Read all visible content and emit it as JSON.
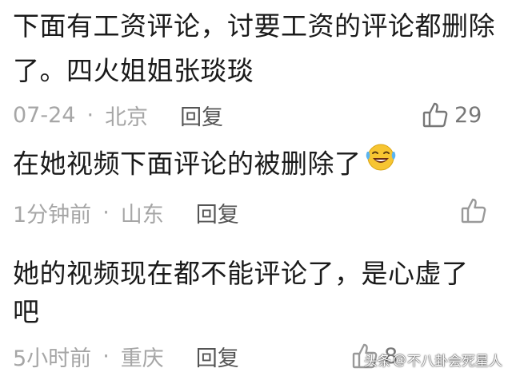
{
  "comments": [
    {
      "lines": [
        "下面有工资评论，讨要工资的评论都删除",
        "了。四火姐姐张琰琰"
      ],
      "location_time": "07-24",
      "region": "北京",
      "reply_label": "回复",
      "likes": "29"
    },
    {
      "lines": [
        "在她视频下面评论的被删除了"
      ],
      "emoji_name": "laughing-crying-emoji",
      "location_time": "1分钟前",
      "region": "山东",
      "reply_label": "回复",
      "likes": ""
    },
    {
      "lines": [
        "她的视频现在都不能评论了，是心虚了",
        "吧"
      ],
      "location_time": "5小时前",
      "region": "重庆",
      "reply_label": "回复",
      "likes": "8"
    }
  ],
  "meta_separator": "·",
  "watermark": {
    "brand": "头条",
    "at": "@",
    "account": "不八卦会死星人"
  },
  "colors": {
    "text": "#1a1a1a",
    "meta": "#a6a6a6",
    "reply": "#555555",
    "like_icon": "#777777"
  },
  "icons": {
    "like": "thumbs-up-icon"
  }
}
